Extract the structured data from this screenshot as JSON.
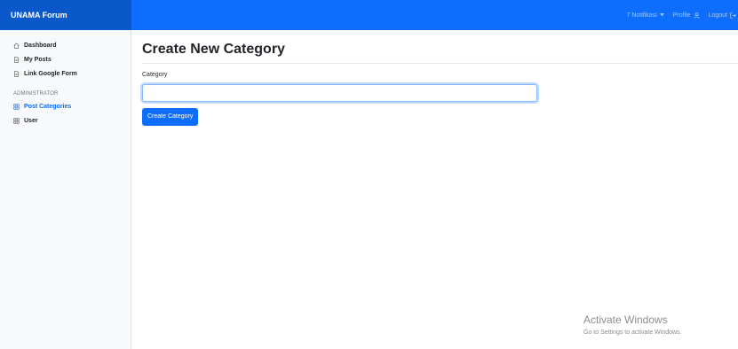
{
  "header": {
    "brand": "UNAMA Forum",
    "notifications": "7 Notifikasi",
    "profile": "Profile",
    "logout": "Logout"
  },
  "sidebar": {
    "items": [
      {
        "label": "Dashboard",
        "icon": "home-icon"
      },
      {
        "label": "My Posts",
        "icon": "file-icon"
      },
      {
        "label": "Link Google Form",
        "icon": "file-icon"
      }
    ],
    "admin_heading": "ADMINISTRATOR",
    "admin_items": [
      {
        "label": "Post Categories",
        "icon": "grid-icon",
        "active": true
      },
      {
        "label": "User",
        "icon": "grid-icon"
      }
    ]
  },
  "main": {
    "title": "Create New Category",
    "field_label": "Category",
    "field_value": "",
    "submit_label": "Create Category"
  },
  "watermark": {
    "title": "Activate Windows",
    "subtitle": "Go to Settings to activate Windows."
  },
  "colors": {
    "primary": "#0d6efd",
    "brand_bg": "#0a58ca",
    "sidebar_bg": "#f8f9fa"
  }
}
